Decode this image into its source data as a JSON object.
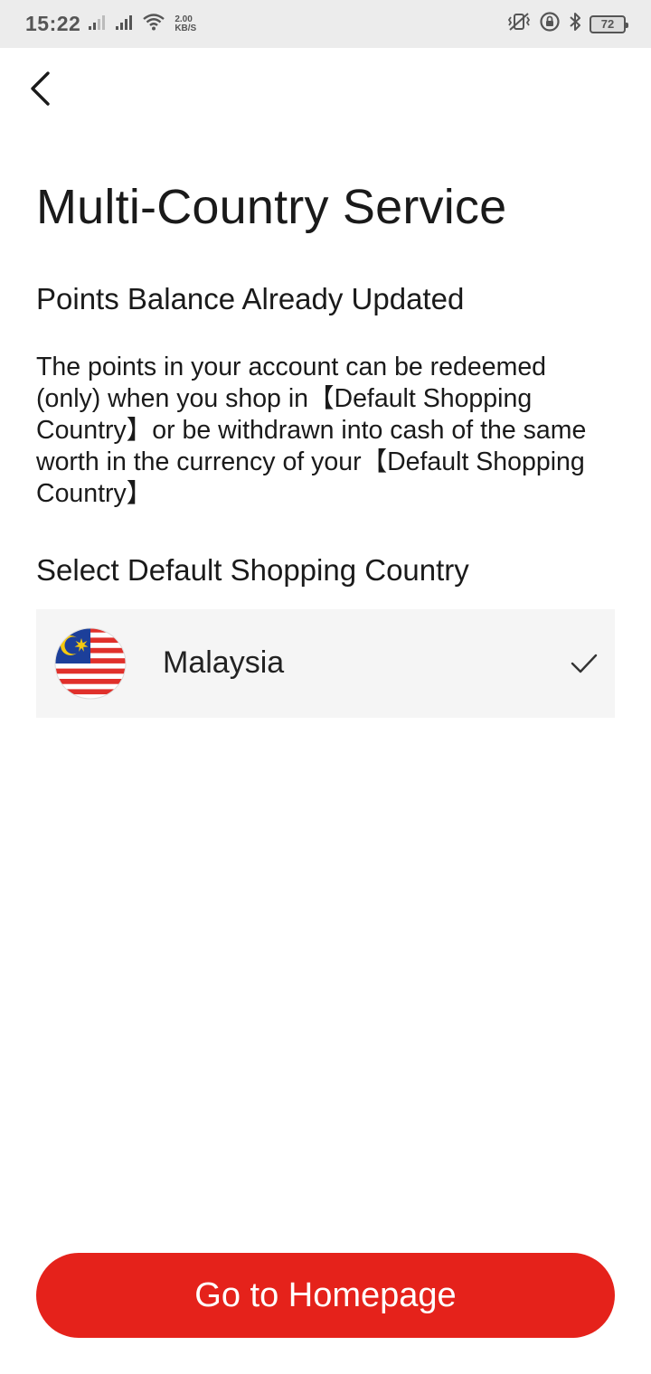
{
  "status_bar": {
    "time": "15:22",
    "speed_value": "2.00",
    "speed_unit": "KB/S",
    "battery": "72"
  },
  "header": {
    "back_icon": "chevron-left-icon"
  },
  "main": {
    "title": "Multi-Country Service",
    "subtitle": "Points Balance Already Updated",
    "description": "The points in your account can be redeemed (only) when you shop in【Default Shopping Country】or be withdrawn into cash of the same worth in the currency of your【Default Shopping Country】",
    "select_label": "Select Default Shopping Country",
    "country": {
      "name": "Malaysia",
      "flag_icon": "malaysia-flag-icon",
      "selected": true,
      "check_icon": "checkmark-icon"
    }
  },
  "footer": {
    "home_button_label": "Go to Homepage",
    "button_color": "#e5221b"
  }
}
